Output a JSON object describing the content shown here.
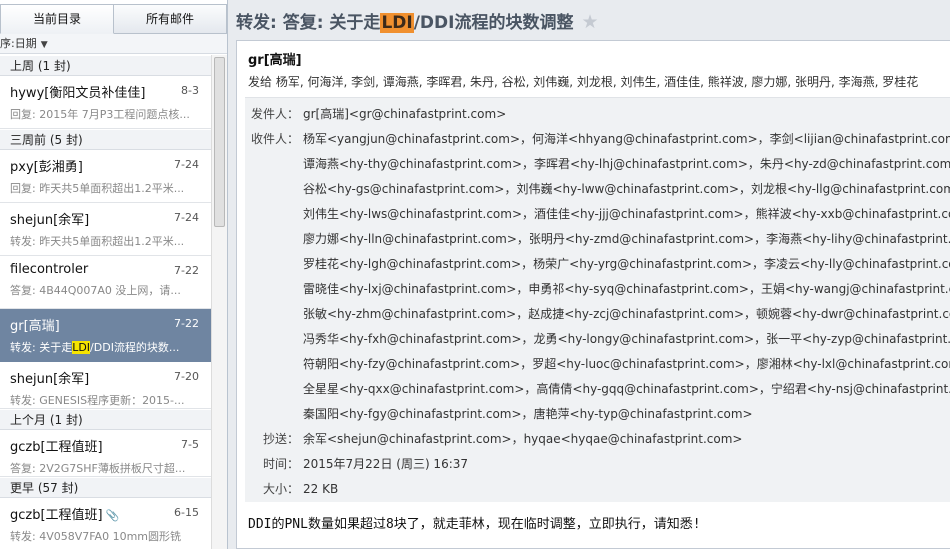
{
  "tabs": {
    "current_dir": "当前目录",
    "all_mail": "所有邮件"
  },
  "sort": {
    "label": "序:日期"
  },
  "groups": {
    "last_week": "上周 (1 封)",
    "three_weeks": "三周前 (5 封)",
    "last_month": "上个月 (1 封)",
    "older": "更早 (57 封)"
  },
  "mails": [
    {
      "from": "hywy[衡阳文员补佳佳]",
      "date": "8-3",
      "preview": "回复: 2015年 7月P3工程问题点核..."
    },
    {
      "from": "pxy[彭湘勇]",
      "date": "7-24",
      "preview": "回复: 昨天共5单面积超出1.2平米..."
    },
    {
      "from": "shejun[余军]",
      "date": "7-24",
      "preview": "转发: 昨天共5单面积超出1.2平米..."
    },
    {
      "from": "filecontroler",
      "date": "7-22",
      "preview": "答复: 4B44Q007A0 没上网，请..."
    },
    {
      "from": "gr[高瑞]",
      "date": "7-22",
      "preview_pre": "转发: 关于走",
      "preview_hl": "LDI",
      "preview_post": "/DDI流程的块数..."
    },
    {
      "from": "shejun[余军]",
      "date": "7-20",
      "preview": "转发: GENESIS程序更新：2015-..."
    },
    {
      "from": "gczb[工程值班]",
      "date": "7-5",
      "preview": "答复: 2V2G7SHF薄板拼板尺寸超..."
    },
    {
      "from": "gczb[工程值班]",
      "date": "6-15",
      "preview": "转发: 4V058V7FA0 10mm圆形铣"
    }
  ],
  "message": {
    "subject_pre": "转发: 答复: 关于走",
    "subject_hl": "LDI",
    "subject_post": "/DDI流程的块数调整",
    "sender": "gr[高瑞]",
    "sent_to": "发给 杨军, 何海洋, 李剑, 谭海燕, 李晖君, 朱丹, 谷松, 刘伟巍, 刘龙根, 刘伟生, 酒佳佳, 熊祥波, 廖力娜, 张明丹, 李海燕, 罗桂花",
    "labels": {
      "from": "发件人：",
      "to": "收件人：",
      "cc": "抄送：",
      "time": "时间：",
      "size": "大小："
    },
    "from_full": "gr[高瑞]<gr@chinafastprint.com>",
    "recipients": [
      "杨军<yangjun@chinafastprint.com>，何海洋<hhyang@chinafastprint.com>，李剑<lijian@chinafastprint.com>，",
      "谭海燕<hy-thy@chinafastprint.com>，李晖君<hy-lhj@chinafastprint.com>，朱丹<hy-zd@chinafastprint.com>，",
      "谷松<hy-gs@chinafastprint.com>，刘伟巍<hy-lww@chinafastprint.com>，刘龙根<hy-llg@chinafastprint.com>，",
      "刘伟生<hy-lws@chinafastprint.com>，酒佳佳<hy-jjj@chinafastprint.com>，熊祥波<hy-xxb@chinafastprint.com>，",
      "廖力娜<hy-lln@chinafastprint.com>，张明丹<hy-zmd@chinafastprint.com>，李海燕<hy-lihy@chinafastprint.com>，",
      "罗桂花<hy-lgh@chinafastprint.com>，杨荣广<hy-yrg@chinafastprint.com>，李凌云<hy-lly@chinafastprint.com>，",
      "雷晓佳<hy-lxj@chinafastprint.com>，申勇祁<hy-syq@chinafastprint.com>，王娟<hy-wangj@chinafastprint.com>，",
      "张敏<hy-zhm@chinafastprint.com>，赵成捷<hy-zcj@chinafastprint.com>，顿婉蓉<hy-dwr@chinafastprint.com>，",
      "冯秀华<hy-fxh@chinafastprint.com>，龙勇<hy-longy@chinafastprint.com>，张一平<hy-zyp@chinafastprint.com>，",
      "符朝阳<hy-fzy@chinafastprint.com>，罗超<hy-luoc@chinafastprint.com>，廖湘林<hy-lxl@chinafastprint.com>，",
      "全星星<hy-qxx@chinafastprint.com>，高倩倩<hy-gqq@chinafastprint.com>，宁绍君<hy-nsj@chinafastprint.com>，",
      "秦国阳<hy-fgy@chinafastprint.com>，唐艳萍<hy-typ@chinafastprint.com>"
    ],
    "cc": "余军<shejun@chinafastprint.com>，hyqae<hyqae@chinafastprint.com>",
    "time": "2015年7月22日 (周三) 16:37",
    "size": "22 KB",
    "body": "DDI的PNL数量如果超过8块了，就走菲林，现在临时调整，立即执行，请知悉!"
  },
  "colors": {
    "selected_row": "#6f85a1",
    "subject_highlight": "#f0902f",
    "preview_highlight": "#f6e400",
    "title_text": "#4a5563"
  },
  "icons": {
    "star": "star-icon",
    "attachment": "paperclip-icon",
    "sort_caret": "chevron-down-icon"
  }
}
